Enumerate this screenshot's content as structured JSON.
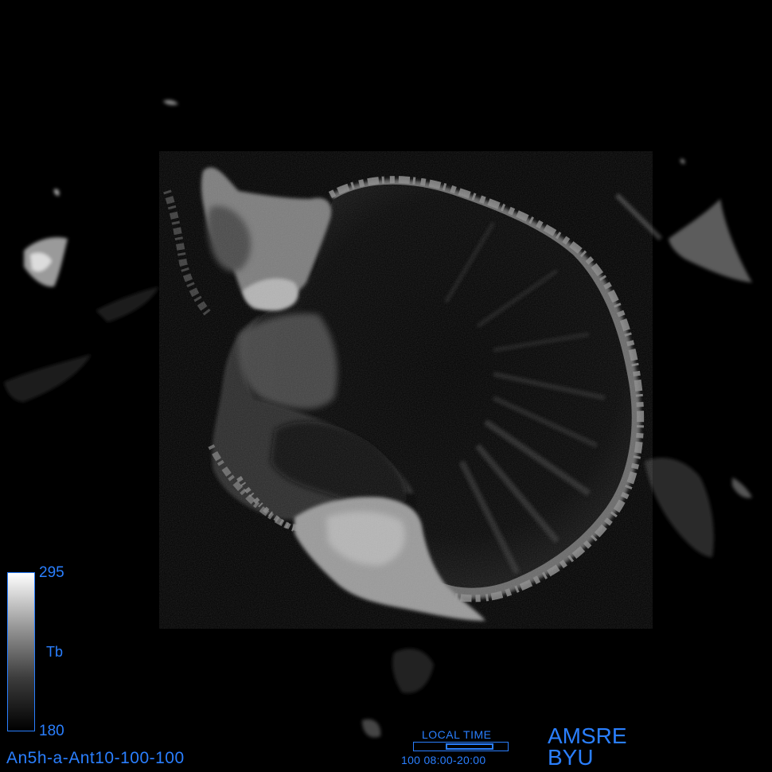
{
  "map": {
    "projection": "south-polar-stereographic",
    "region": "Antarctica",
    "palette": "grayscale"
  },
  "colorbar": {
    "max_label": "295",
    "min_label": "180",
    "variable": "Tb",
    "gradient": [
      "#ffffff",
      "#9a9a9a",
      "#3c3c3c",
      "#000000"
    ]
  },
  "product_id": "An5h-a-Ant10-100-100",
  "local_time": {
    "label": "LOCAL TIME",
    "range_text": "100 08:00-20:00"
  },
  "sensor": "AMSRE",
  "organization": "BYU",
  "colors": {
    "annotation": "#2a7fff",
    "background": "#000000"
  }
}
